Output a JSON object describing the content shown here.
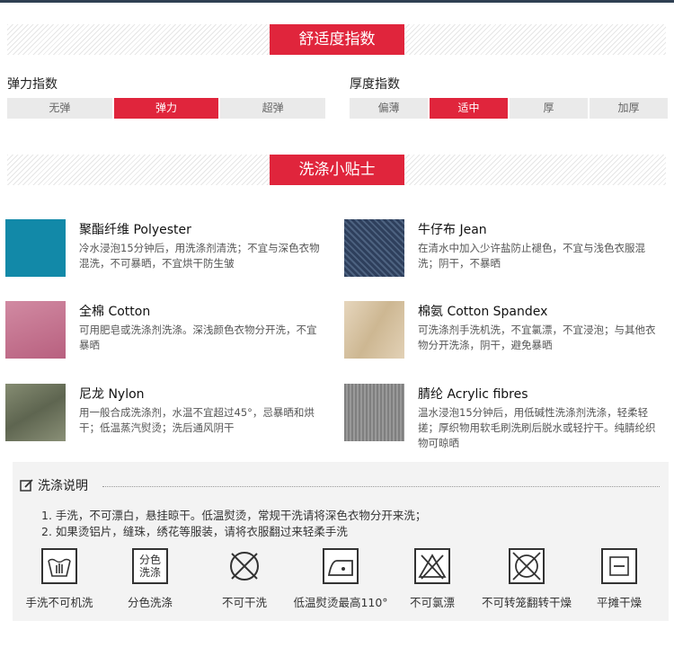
{
  "comfort": {
    "title": "舒适度指数",
    "elasticity": {
      "label": "弹力指数",
      "options": [
        "无弹",
        "弹力",
        "超弹"
      ],
      "selected": 1
    },
    "thickness": {
      "label": "厚度指数",
      "options": [
        "偏薄",
        "适中",
        "厚",
        "加厚"
      ],
      "selected": 1
    }
  },
  "tips": {
    "title": "洗涤小贴士",
    "items": [
      {
        "name": "聚酯纤维 Polyester",
        "desc": "冷水浸泡15分钟后，用洗涤剂清洗；不宜与深色衣物混洗，不可暴晒，不宜烘干防生皱",
        "color": "#1289a8"
      },
      {
        "name": "牛仔布 Jean",
        "desc": "在清水中加入少许盐防止褪色，不宜与浅色衣服混洗；阴干，不暴晒",
        "color": "#3a4e6e"
      },
      {
        "name": "全棉 Cotton",
        "desc": "可用肥皂或洗涤剂洗涤。深浅颜色衣物分开洗，不宜暴晒",
        "color": "#c4718e"
      },
      {
        "name": "棉氨 Cotton Spandex",
        "desc": "可洗涤剂手洗机洗，不宜氯漂，不宜浸泡；与其他衣物分开洗涤，阴干，避免暴晒",
        "color": "#dcc9aa"
      },
      {
        "name": "尼龙 Nylon",
        "desc": "用一般合成洗涤剂，水温不宜超过45°，忌暴晒和烘干；低温蒸汽熨烫；洗后通风阴干",
        "color": "#757c63"
      },
      {
        "name": "腈纶 Acrylic fibres",
        "desc": "温水浸泡15分钟后，用低碱性洗涤剂洗涤，轻柔轻搓；厚织物用软毛刷洗刷后脱水或轻拧干。纯腈纶织物可晾晒",
        "color": "#8a8a8a"
      }
    ]
  },
  "instructions": {
    "title": "洗涤说明",
    "rules": [
      "1. 手洗，不可漂白，悬挂晾干。低温熨烫，常规干洗请将深色衣物分开来洗；",
      "2. 如果烫铝片，缝珠，绣花等服装，请将衣服翻过来轻柔手洗"
    ],
    "symbols": [
      {
        "icon": "hand-wash-icon",
        "label": "手洗不可机洗"
      },
      {
        "icon": "separate-colors-icon",
        "label": "分色洗涤",
        "icon_text": "分色洗涤"
      },
      {
        "icon": "no-dry-clean-icon",
        "label": "不可干洗"
      },
      {
        "icon": "low-iron-icon",
        "label": "低温熨烫最高110°"
      },
      {
        "icon": "no-bleach-icon",
        "label": "不可氯漂"
      },
      {
        "icon": "no-tumble-dry-icon",
        "label": "不可转笼翻转干燥"
      },
      {
        "icon": "dry-flat-icon",
        "label": "平摊干燥"
      }
    ]
  }
}
